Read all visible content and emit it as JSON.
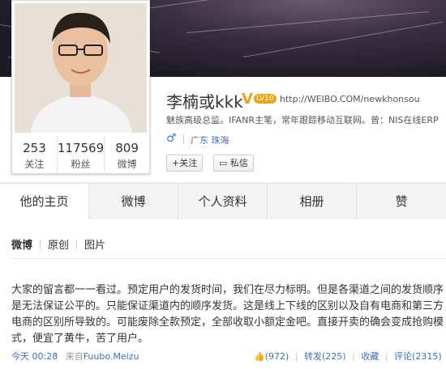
{
  "profile": {
    "name": "李楠或kkk",
    "verified_badge": "V",
    "level_badge": "LV10",
    "url": "http://WEIBO.COM/newkhonsou",
    "bio": "魅族高级总监。IFANR主笔，常年跟踪移动互联网。曾：NIS在线ERP",
    "gender_icon": "♂",
    "location": "广东 珠海",
    "follow_button": "+关注",
    "message_button": "私信"
  },
  "stats": [
    {
      "value": "253",
      "label": "关注"
    },
    {
      "value": "117569",
      "label": "粉丝"
    },
    {
      "value": "809",
      "label": "微博"
    }
  ],
  "tabs": [
    {
      "label": "他的主页"
    },
    {
      "label": "微博"
    },
    {
      "label": "个人资料"
    },
    {
      "label": "相册"
    },
    {
      "label": "赞"
    }
  ],
  "subtabs": [
    {
      "label": "微博"
    },
    {
      "label": "原创"
    },
    {
      "label": "图片"
    }
  ],
  "post": {
    "text": "大家的留言都一一看过。预定用户的发货时间，我们在尽力标明。但是各渠道之间的发货顺序是无法保证公平的。只能保证渠道内的顺序发货。这是线上下线的区别以及自有电商和第三方电商的区别所导致的。可能废除全款预定，全部收取小额定金吧。直接开卖的确会变成抢购模式，便宜了黄牛，苦了用户。",
    "time": "今天 00:28",
    "source_prefix": "来自",
    "source": "Fuubo.Meizu",
    "likes": "(972)",
    "repost": "转发(225)",
    "favorite": "收藏",
    "comment": "评论(2315)"
  },
  "colors": {
    "link": "#3b6fb3",
    "badge": "#e8a317"
  }
}
